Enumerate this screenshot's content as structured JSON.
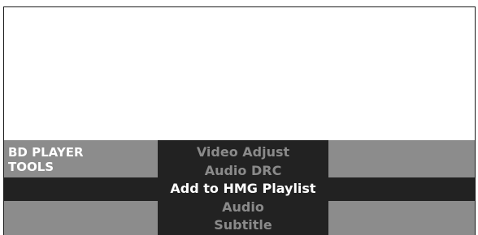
{
  "panel": {
    "title_line1": "BD PLAYER",
    "title_line2": "TOOLS"
  },
  "menu": {
    "items": [
      {
        "label": "Video Adjust",
        "selected": false
      },
      {
        "label": "Audio DRC",
        "selected": false
      },
      {
        "label": "Add to HMG Playlist",
        "selected": true
      },
      {
        "label": "Audio",
        "selected": false
      },
      {
        "label": "Subtitle",
        "selected": false
      }
    ]
  },
  "colors": {
    "panel_gray": "#8c8c8c",
    "menu_dark": "#222222",
    "text_dim": "#8a8a8a",
    "text_selected": "#ffffff"
  }
}
